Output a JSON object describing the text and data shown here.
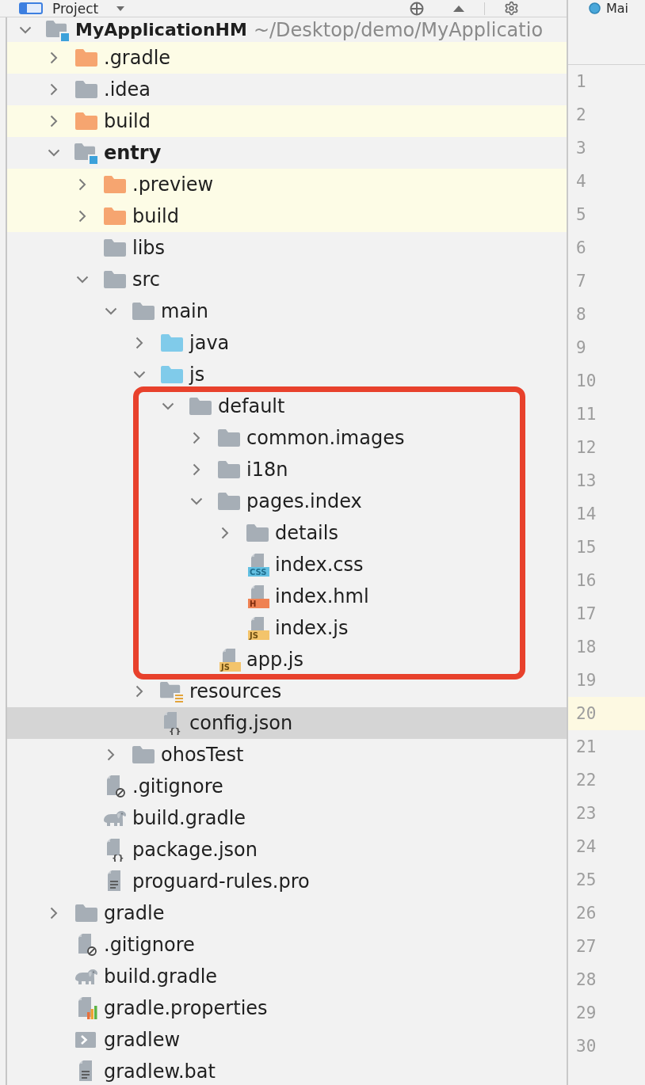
{
  "header": {
    "title": "Project"
  },
  "editor_tab": {
    "title": "Mai"
  },
  "project_tree": [
    {
      "name": "MyApplicationHM",
      "path": "~/Desktop/demo/MyApplicatio",
      "kind": "module",
      "expanded": true,
      "selected": false,
      "ignored": false,
      "children": [
        {
          "name": ".gradle",
          "kind": "excluded_folder",
          "expanded": false,
          "selected": false,
          "ignored": true
        },
        {
          "name": ".idea",
          "kind": "folder",
          "expanded": false,
          "selected": false,
          "ignored": false
        },
        {
          "name": "build",
          "kind": "excluded_folder",
          "expanded": false,
          "selected": false,
          "ignored": true
        },
        {
          "name": "entry",
          "kind": "module",
          "expanded": true,
          "selected": false,
          "ignored": false,
          "children": [
            {
              "name": ".preview",
              "kind": "excluded_folder",
              "expanded": false,
              "selected": false,
              "ignored": true
            },
            {
              "name": "build",
              "kind": "excluded_folder",
              "expanded": false,
              "selected": false,
              "ignored": true
            },
            {
              "name": "libs",
              "kind": "folder",
              "selected": false,
              "ignored": false
            },
            {
              "name": "src",
              "kind": "folder",
              "expanded": true,
              "selected": false,
              "ignored": false,
              "children": [
                {
                  "name": "main",
                  "kind": "folder",
                  "expanded": true,
                  "selected": false,
                  "ignored": false,
                  "children": [
                    {
                      "name": "java",
                      "kind": "source_folder",
                      "expanded": false,
                      "selected": false,
                      "ignored": false
                    },
                    {
                      "name": "js",
                      "kind": "source_folder",
                      "expanded": true,
                      "selected": false,
                      "ignored": false,
                      "children": [
                        {
                          "name": "default",
                          "kind": "folder",
                          "expanded": true,
                          "selected": false,
                          "ignored": false,
                          "annotated": true,
                          "children": [
                            {
                              "name": "common.images",
                              "kind": "folder",
                              "expanded": false,
                              "selected": false,
                              "ignored": false
                            },
                            {
                              "name": "i18n",
                              "kind": "folder",
                              "expanded": false,
                              "selected": false,
                              "ignored": false
                            },
                            {
                              "name": "pages.index",
                              "kind": "folder",
                              "expanded": true,
                              "selected": false,
                              "ignored": false,
                              "children": [
                                {
                                  "name": "details",
                                  "kind": "folder",
                                  "expanded": false,
                                  "selected": false,
                                  "ignored": false
                                },
                                {
                                  "name": "index.css",
                                  "kind": "css",
                                  "badge": "CSS",
                                  "selected": false,
                                  "ignored": false
                                },
                                {
                                  "name": "index.hml",
                                  "kind": "hml",
                                  "badge": "H",
                                  "selected": false,
                                  "ignored": false
                                },
                                {
                                  "name": "index.js",
                                  "kind": "js",
                                  "badge": "JS",
                                  "selected": false,
                                  "ignored": false
                                }
                              ]
                            },
                            {
                              "name": "app.js",
                              "kind": "js",
                              "badge": "JS",
                              "selected": false,
                              "ignored": false
                            }
                          ]
                        }
                      ]
                    },
                    {
                      "name": "resources",
                      "kind": "resources_folder",
                      "expanded": false,
                      "selected": false,
                      "ignored": false
                    },
                    {
                      "name": "config.json",
                      "kind": "json",
                      "badge": "{}",
                      "selected": true,
                      "ignored": false
                    }
                  ]
                },
                {
                  "name": "ohosTest",
                  "kind": "folder",
                  "expanded": false,
                  "selected": false,
                  "ignored": false
                }
              ]
            },
            {
              "name": ".gitignore",
              "kind": "ignore",
              "selected": false,
              "ignored": false
            },
            {
              "name": "build.gradle",
              "kind": "gradle",
              "selected": false,
              "ignored": false
            },
            {
              "name": "package.json",
              "kind": "json",
              "badge": "{}",
              "selected": false,
              "ignored": false
            },
            {
              "name": "proguard-rules.pro",
              "kind": "text",
              "selected": false,
              "ignored": false
            }
          ]
        },
        {
          "name": "gradle",
          "kind": "folder",
          "expanded": false,
          "selected": false,
          "ignored": false
        },
        {
          "name": ".gitignore",
          "kind": "ignore",
          "selected": false,
          "ignored": false
        },
        {
          "name": "build.gradle",
          "kind": "gradle",
          "selected": false,
          "ignored": false
        },
        {
          "name": "gradle.properties",
          "kind": "properties",
          "selected": false,
          "ignored": false
        },
        {
          "name": "gradlew",
          "kind": "script",
          "selected": false,
          "ignored": false
        },
        {
          "name": "gradlew.bat",
          "kind": "text",
          "selected": false,
          "ignored": false
        }
      ]
    }
  ],
  "gutter": {
    "lines": [
      {
        "number": "1",
        "current": false
      },
      {
        "number": "2",
        "current": false
      },
      {
        "number": "3",
        "current": false
      },
      {
        "number": "4",
        "current": false
      },
      {
        "number": "5",
        "current": false
      },
      {
        "number": "6",
        "current": false
      },
      {
        "number": "7",
        "current": false
      },
      {
        "number": "8",
        "current": false
      },
      {
        "number": "9",
        "current": false
      },
      {
        "number": "10",
        "current": false
      },
      {
        "number": "11",
        "current": false
      },
      {
        "number": "12",
        "current": false
      },
      {
        "number": "13",
        "current": false
      },
      {
        "number": "14",
        "current": false
      },
      {
        "number": "15",
        "current": false
      },
      {
        "number": "16",
        "current": false
      },
      {
        "number": "17",
        "current": false
      },
      {
        "number": "18",
        "current": false
      },
      {
        "number": "19",
        "current": false
      },
      {
        "number": "20",
        "current": true
      },
      {
        "number": "21",
        "current": false
      },
      {
        "number": "22",
        "current": false
      },
      {
        "number": "23",
        "current": false
      },
      {
        "number": "24",
        "current": false
      },
      {
        "number": "25",
        "current": false
      },
      {
        "number": "26",
        "current": false
      },
      {
        "number": "27",
        "current": false
      },
      {
        "number": "28",
        "current": false
      },
      {
        "number": "29",
        "current": false
      },
      {
        "number": "30",
        "current": false
      }
    ]
  }
}
